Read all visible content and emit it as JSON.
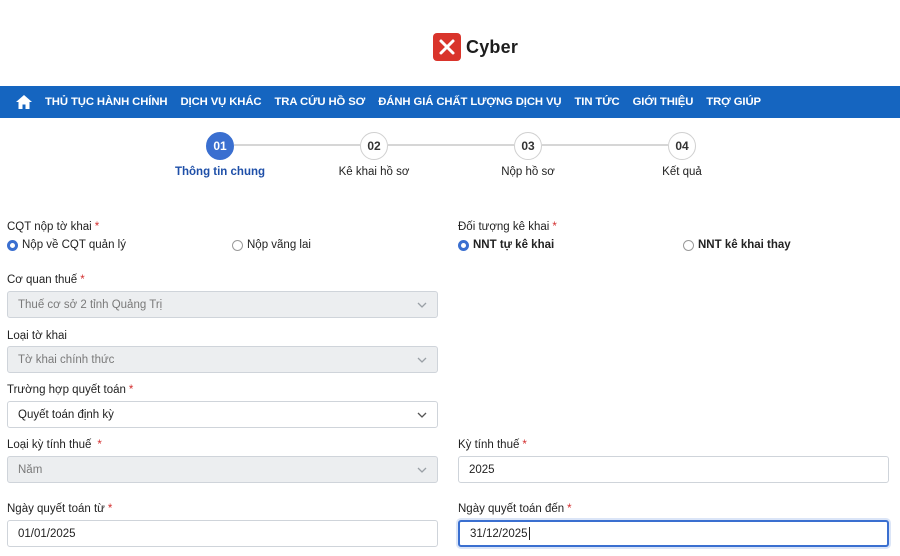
{
  "logo": {
    "text": "Cyber"
  },
  "nav": {
    "items": [
      "THỦ TỤC HÀNH CHÍNH",
      "DỊCH VỤ KHÁC",
      "TRA CỨU HỒ SƠ",
      "ĐÁNH GIÁ CHẤT LƯỢNG DỊCH VỤ",
      "TIN TỨC",
      "GIỚI THIỆU",
      "TRỢ GIÚP"
    ],
    "bar_color": "#1565c0"
  },
  "steps": [
    {
      "number": "01",
      "label": "Thông tin chung",
      "active": true
    },
    {
      "number": "02",
      "label": "Kê khai hồ sơ",
      "active": false
    },
    {
      "number": "03",
      "label": "Nộp hồ sơ",
      "active": false
    },
    {
      "number": "04",
      "label": "Kết quả",
      "active": false
    }
  ],
  "form": {
    "cqt_nop": {
      "label": "CQT nộp tờ khai",
      "options": [
        "Nộp về CQT quản lý",
        "Nộp vãng lai"
      ],
      "selected": "Nộp về CQT quản lý"
    },
    "doi_tuong": {
      "label": "Đối tượng kê khai",
      "options": [
        "NNT tự kê khai",
        "NNT kê khai thay"
      ],
      "selected": "NNT tự kê khai"
    },
    "co_quan_thue": {
      "label": "Cơ quan thuế",
      "value": "Thuế cơ sở 2 tỉnh Quảng Trị"
    },
    "loai_to_khai": {
      "label": "Loại tờ khai",
      "value": "Tờ khai chính thức"
    },
    "truong_hop": {
      "label": "Trường hợp quyết toán",
      "value": "Quyết toán định kỳ"
    },
    "loai_ky": {
      "label": "Loại kỳ tính thuế",
      "value": "Năm"
    },
    "ky_tinh_thue": {
      "label": "Kỳ tính thuế",
      "value": "2025"
    },
    "ngay_tu": {
      "label": "Ngày quyết toán từ",
      "value": "01/01/2025"
    },
    "ngay_den": {
      "label": "Ngày quyết toán đến",
      "value": "31/12/2025"
    },
    "required_mark": "*"
  },
  "colors": {
    "accent": "#3a6fd0",
    "required": "#d32f2f",
    "logo": "#d9342b"
  }
}
